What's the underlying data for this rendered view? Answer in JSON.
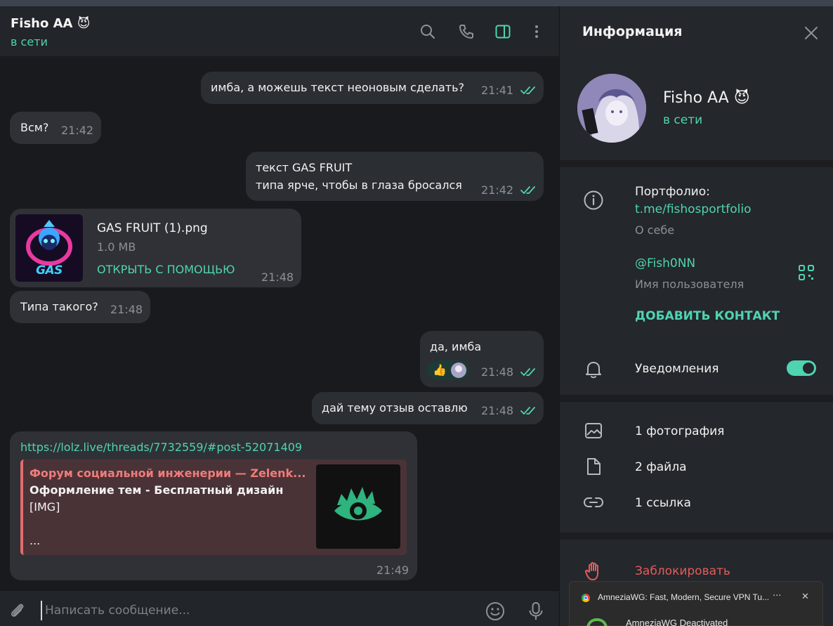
{
  "chat": {
    "name": "Fisho AA",
    "emoji": "😈",
    "status": "в сети"
  },
  "messages": [
    {
      "text": "имба, а можешь текст неоновым сделать?",
      "time": "21:41"
    },
    {
      "text": "Всм?",
      "time": "21:42"
    },
    {
      "line1": "текст GAS FRUIT",
      "line2": "типа ярче, чтобы в глаза бросался",
      "time": "21:42"
    },
    {
      "file_name": "GAS FRUIT (1).png",
      "file_size": "1.0 MB",
      "open_with": "ОТКРЫТЬ С ПОМОЩЬЮ",
      "thumb_text": "GAS FRUIT",
      "time": "21:48"
    },
    {
      "text": "Типа такого?",
      "time": "21:48"
    },
    {
      "text": "да, имба",
      "reaction": "👍",
      "time": "21:48"
    },
    {
      "text": "дай тему отзыв оставлю",
      "time": "21:48"
    },
    {
      "link": "https://lolz.live/threads/7732559/#post-52071409",
      "preview_site": "Форум социальной инженерии — Zelenk...",
      "preview_title": "Оформление тем - Бесплатный дизайн",
      "preview_body": "[IMG]",
      "preview_more": "...",
      "time": "21:49"
    }
  ],
  "composer": {
    "placeholder": "Написать сообщение..."
  },
  "info": {
    "title": "Информация",
    "name": "Fisho AA",
    "emoji": "😈",
    "status": "в сети",
    "bio_prefix": "Портфолио:",
    "bio_link": "t.me/fishosportfolio",
    "bio_caption": "О себе",
    "username": "@Fish0NN",
    "username_caption": "Имя пользователя",
    "add_contact": "ДОБАВИТЬ КОНТАКТ",
    "notifications": "Уведомления",
    "notifications_on": true,
    "photos": "1 фотография",
    "files": "2 файла",
    "links": "1 ссылка",
    "block": "Заблокировать"
  },
  "toast": {
    "title": "AmneziaWG: Fast, Modern, Secure VPN Tu...",
    "subtitle": "AmneziaWG Deactivated",
    "more": "···",
    "close": "✕"
  },
  "colors": {
    "accent": "#4fd4b2",
    "danger": "#e55b5b"
  }
}
